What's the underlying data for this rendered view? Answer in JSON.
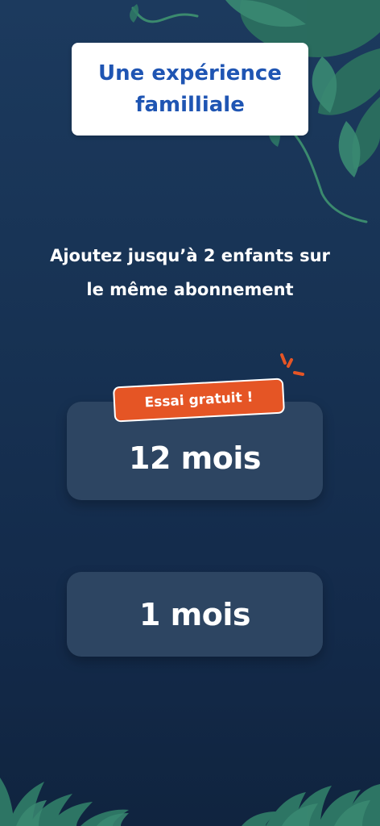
{
  "header": {
    "title": "Une expérience familliale"
  },
  "subtitle": {
    "line1": "Ajoutez jusqu’à 2 enfants sur",
    "line2": "le même abonnement"
  },
  "plans": [
    {
      "label": "12 mois",
      "badge": "Essai gratuit !"
    },
    {
      "label": "1 mois"
    }
  ],
  "icons": {
    "top_decoration": "jungle-leaves-icon",
    "bottom_decoration": "grass-foliage-icon",
    "badge_accent": "sparkle-lines-icon"
  },
  "colors": {
    "background": "#173253",
    "title_text": "#1f55b3",
    "plan_button": "#2d4562",
    "badge": "#e55525",
    "foliage": "#2f7a66"
  }
}
